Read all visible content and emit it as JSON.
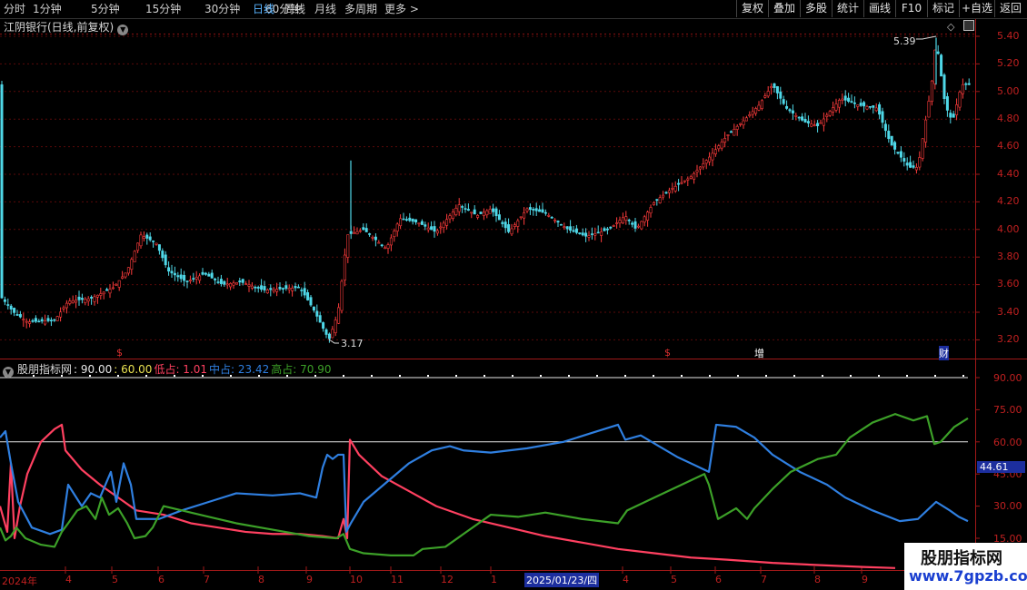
{
  "toolbar": {
    "periods": [
      "分时",
      "1分钟",
      "5分钟",
      "15分钟",
      "30分钟",
      "60分钟",
      "日线",
      "周线",
      "月线",
      "多周期",
      "更多 >"
    ],
    "tools": [
      "复权",
      "叠加",
      "多股",
      "统计",
      "画线",
      "F10",
      "标记",
      "+自选",
      "返回"
    ]
  },
  "stock_title": "江阴银行(日线,前复权)",
  "price_axis": [
    "5.40",
    "5.20",
    "5.00",
    "4.80",
    "4.60",
    "4.40",
    "4.20",
    "4.00",
    "3.80",
    "3.60",
    "3.40",
    "3.20"
  ],
  "annotations": {
    "high": "5.39",
    "low": "3.17"
  },
  "event_markers": [
    "$",
    "$",
    "增",
    "财"
  ],
  "indicator": {
    "name": "股朋指标网",
    "line1": ": 90.00",
    "line2": ": 60.00",
    "low_label": "低占: 1.01",
    "mid_label": "中占: 23.42",
    "high_label": "高占: 70.90"
  },
  "indicator_axis": [
    "90.00",
    "75.00",
    "60.00",
    "45.00",
    "30.00",
    "15.00"
  ],
  "cursor": {
    "date": "2025/01/23/四",
    "value": "44.61"
  },
  "time_axis": [
    "2024年",
    "4",
    "5",
    "6",
    "7",
    "8",
    "9",
    "10",
    "11",
    "12",
    "1",
    "4",
    "5",
    "6",
    "7",
    "8",
    "9"
  ],
  "watermark": {
    "cn": "股朋指标网",
    "url": "www.7gpzb.com"
  },
  "colors": {
    "up": "#ff3c3c",
    "down": "#4fd8e8",
    "low": "#ff4060",
    "mid": "#2f7fe0",
    "high": "#3ca028",
    "axis": "#c02020"
  }
}
